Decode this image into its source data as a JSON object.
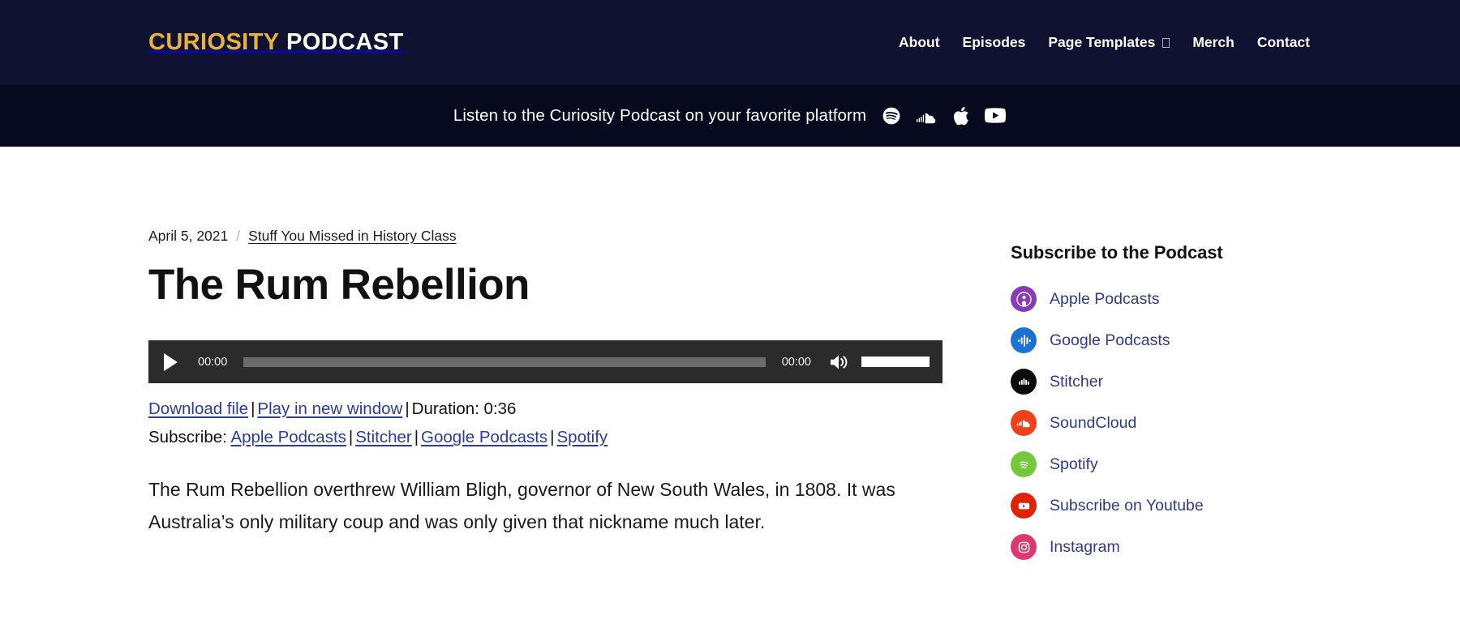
{
  "header": {
    "logo_primary": "CURIOSITY",
    "logo_secondary": "PODCAST",
    "nav": [
      {
        "label": "About",
        "has_dropdown": false
      },
      {
        "label": "Episodes",
        "has_dropdown": false
      },
      {
        "label": "Page Templates",
        "has_dropdown": true
      },
      {
        "label": "Merch",
        "has_dropdown": false
      },
      {
        "label": "Contact",
        "has_dropdown": false
      }
    ]
  },
  "platform_bar": {
    "text": "Listen to the Curiosity Podcast on your favorite platform",
    "icons": [
      "spotify-icon",
      "soundcloud-icon",
      "apple-icon",
      "youtube-icon"
    ]
  },
  "post": {
    "date": "April 5, 2021",
    "separator": "/",
    "category": "Stuff You Missed in History Class",
    "title": "The Rum Rebellion",
    "body": "The Rum Rebellion overthrew William Bligh, governor of New South Wales, in 1808. It was Australia’s only military coup and was only given that nickname much later."
  },
  "player": {
    "current_time": "00:00",
    "total_time": "00:00",
    "play_label": "Play",
    "mute_label": "Mute",
    "progress_percent": 0,
    "volume_percent": 100
  },
  "audio_links": {
    "download": "Download file",
    "play_new_window": "Play in new window",
    "duration": "Duration: 0:36",
    "separator": "|",
    "subscribe_label": "Subscribe:",
    "subscribe_links": [
      "Apple Podcasts",
      "Stitcher",
      "Google Podcasts",
      "Spotify"
    ]
  },
  "sidebar": {
    "title": "Subscribe to the Podcast",
    "items": [
      {
        "label": "Apple Podcasts",
        "icon": "apple-podcasts-icon",
        "color": "#8a3ab9"
      },
      {
        "label": "Google Podcasts",
        "icon": "google-podcasts-icon",
        "color": "#1a73d4"
      },
      {
        "label": "Stitcher",
        "icon": "stitcher-icon",
        "color": "#0b0b0b"
      },
      {
        "label": "SoundCloud",
        "icon": "soundcloud-icon",
        "color": "#f0401a"
      },
      {
        "label": "Spotify",
        "icon": "spotify-icon",
        "color": "#73c83c"
      },
      {
        "label": "Subscribe on Youtube",
        "icon": "youtube-icon",
        "color": "#e02200"
      },
      {
        "label": "Instagram",
        "icon": "instagram-icon",
        "color": "#e0366e"
      }
    ]
  },
  "colors": {
    "header_bg": "#101232",
    "platform_bar_bg": "#070a1e",
    "logo_accent": "#e8b33c",
    "link_blue": "#2b3ba0",
    "player_bg": "#2b2b2b"
  }
}
